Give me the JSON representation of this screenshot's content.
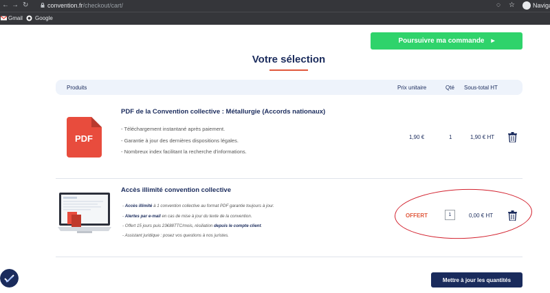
{
  "browser": {
    "url_domain": "convention.fr",
    "url_path": "/checkout/cart/",
    "bookmarks": [
      "Gmail",
      "Google"
    ],
    "profile_label": "Naviga"
  },
  "cta": {
    "label": "Poursuivre ma commande"
  },
  "title": "Votre sélection",
  "table": {
    "headers": {
      "products": "Produits",
      "unit_price": "Prix unitaire",
      "qty": "Qté",
      "subtotal": "Sous-total HT"
    }
  },
  "items": [
    {
      "title": "PDF de la Convention collective : Métallurgie (Accords nationaux)",
      "icon_text": "PDF",
      "bullets": [
        "- Téléchargement instantané après paiement.",
        "- Garantie à jour des dernières dispositions légales.",
        "- Nombreux index facilitant la recherche d'informations."
      ],
      "unit_price": "1,90 €",
      "qty": "1",
      "subtotal": "1,90 €  HT"
    },
    {
      "title": "Accès illimité convention collective",
      "bullets": [
        {
          "bold": "Accès illimité",
          "text": " à 1 convention collective au format PDF garantie toujours à jour."
        },
        {
          "bold": "Alertes par e-mail",
          "text": " en cas de mise à jour du texte de la convention."
        },
        {
          "pre": "Offert 15 jours puis 23€88TTC/mois, résiliation ",
          "bold": "depuis le compte client",
          "text": "."
        },
        {
          "text": "Assistant juridique : posez vos questions à nos juristes."
        }
      ],
      "unit_price": "OFFERT",
      "qty": "1",
      "subtotal": "0,00 €  HT"
    }
  ],
  "update_button": "Mettre à jour les quantités",
  "colors": {
    "cta": "#2fd36b",
    "navy": "#1a2b5c",
    "accent": "#e0563a",
    "highlight_circle": "#d21e2b"
  }
}
